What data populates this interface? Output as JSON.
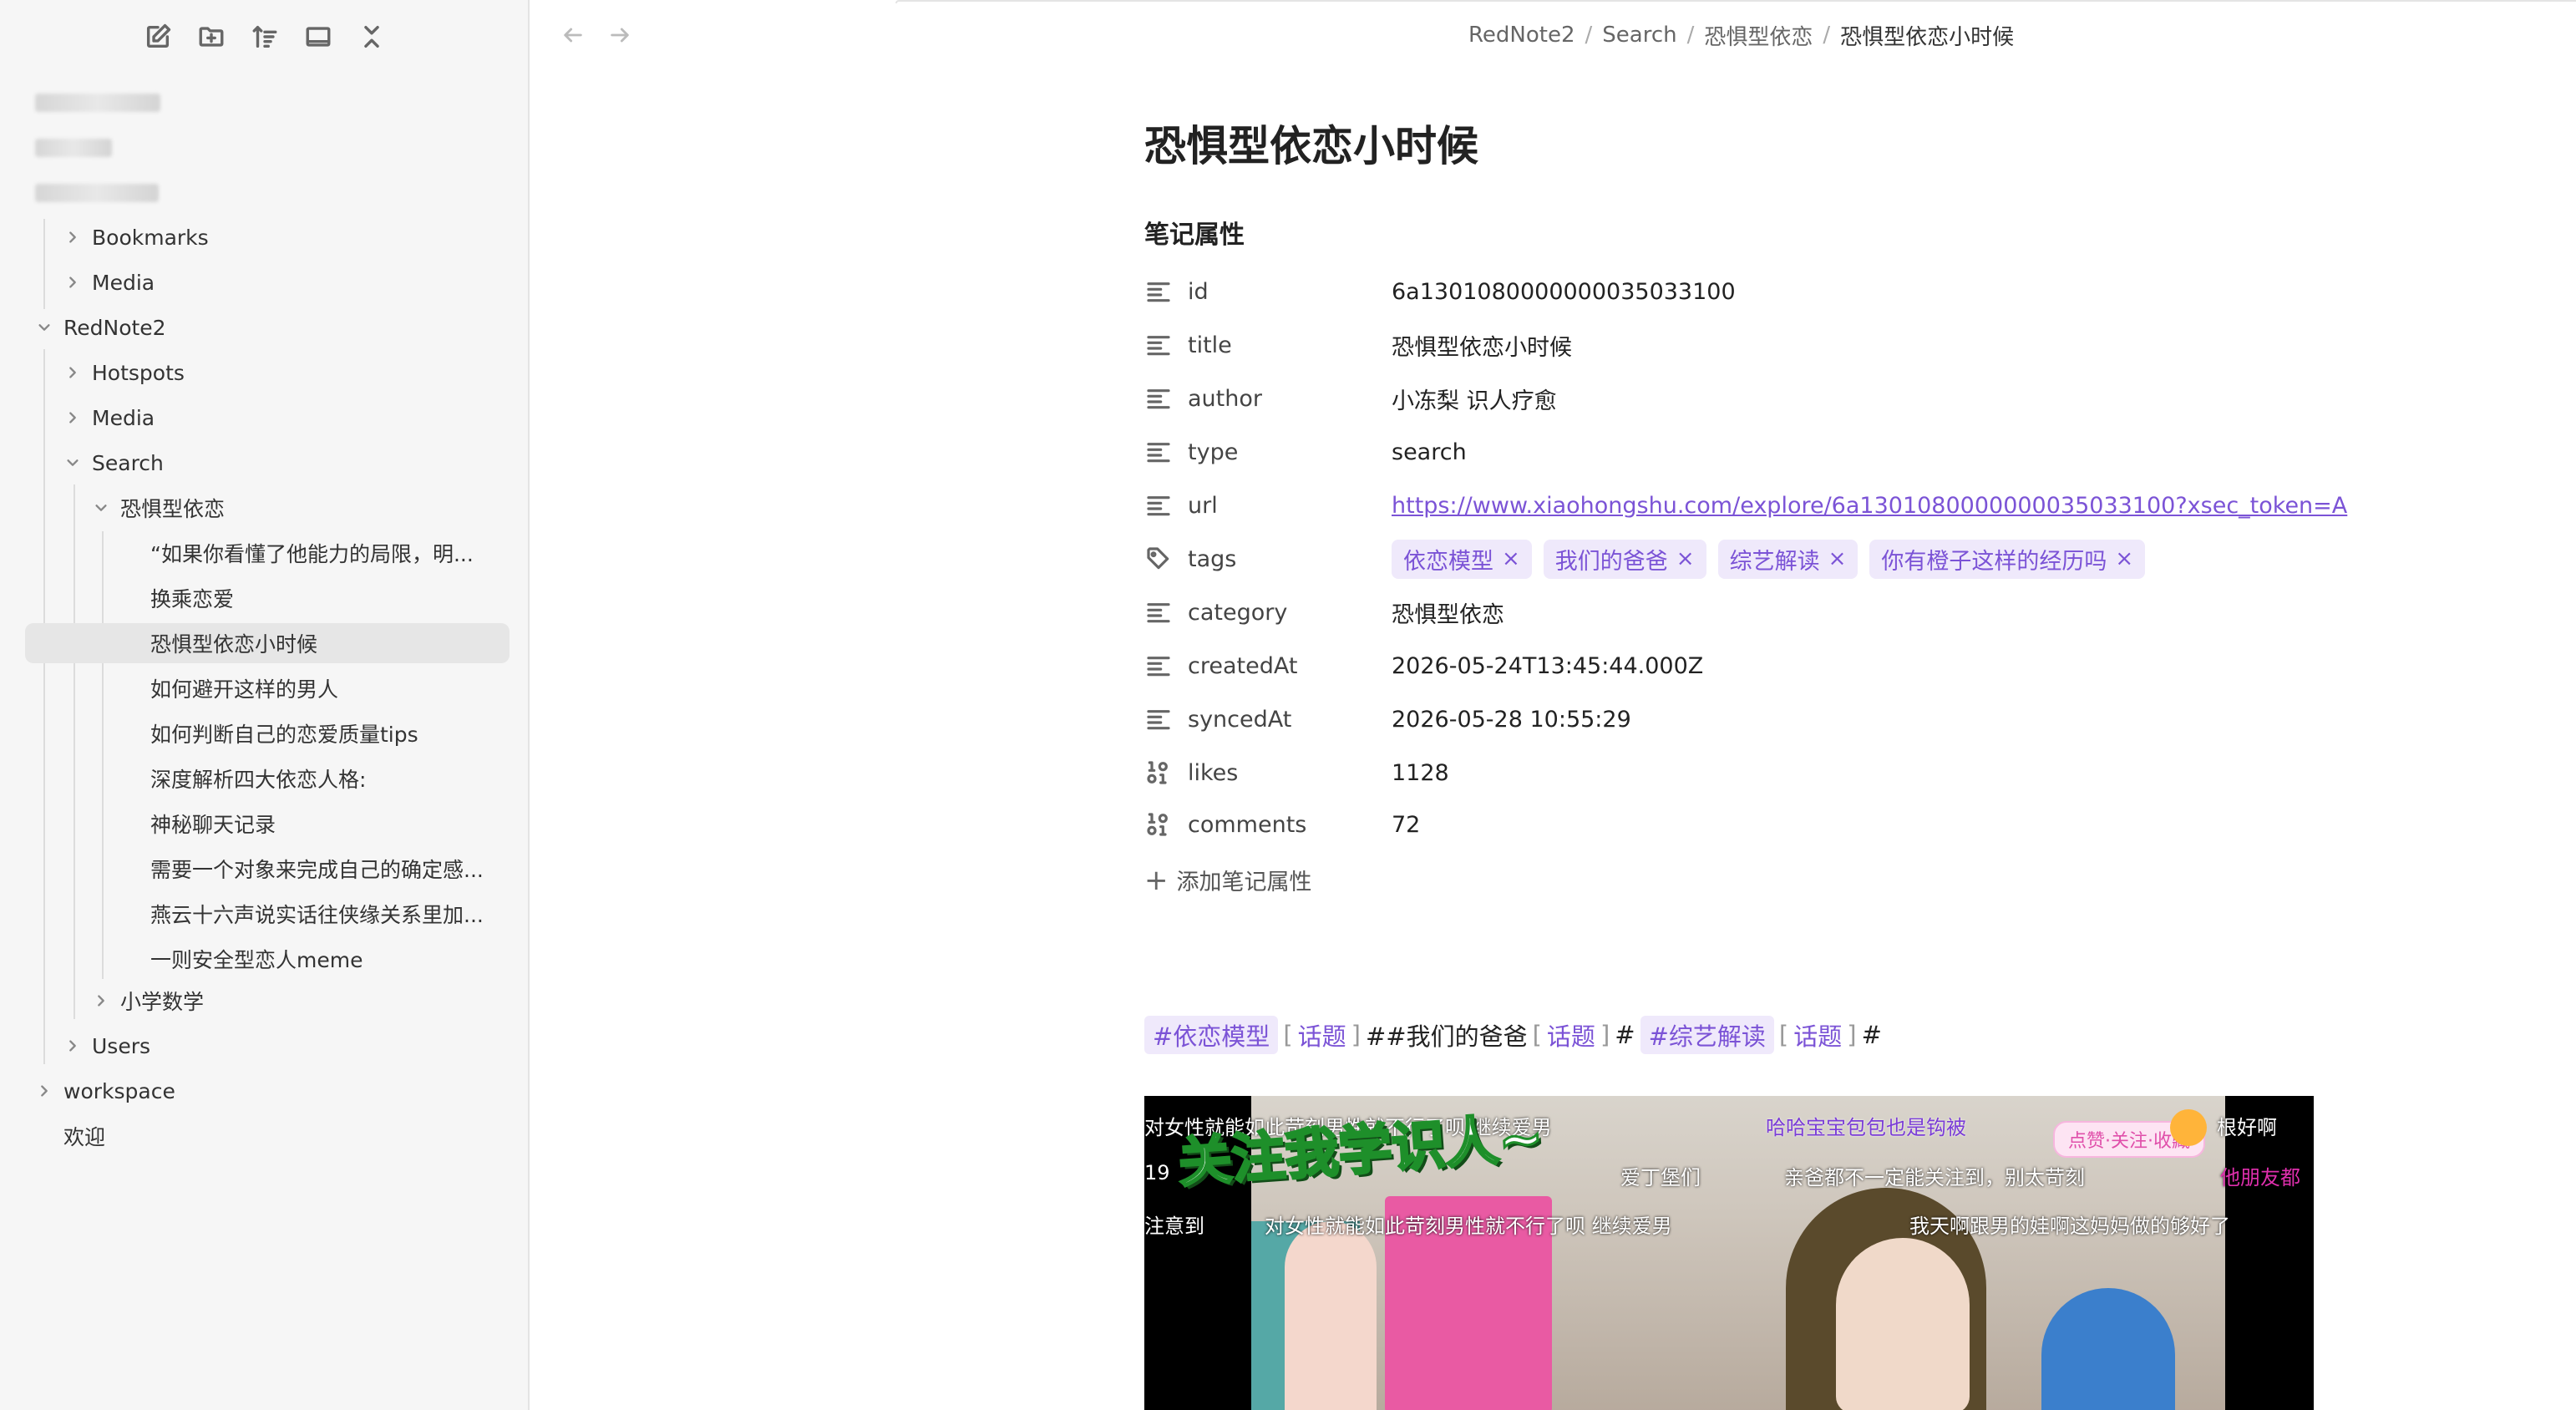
{
  "sidebar": {
    "toolbar": {
      "new_note": "new-note-icon",
      "new_folder": "new-folder-icon",
      "sort": "sort-icon",
      "layout": "layout-icon",
      "collapse": "collapse-icon"
    },
    "tree": [
      {
        "label": "Bookmarks"
      },
      {
        "label": "Media"
      },
      {
        "label": "RedNote2"
      },
      {
        "label": "Hotspots"
      },
      {
        "label": "Media"
      },
      {
        "label": "Search"
      },
      {
        "label": "恐惧型依恋"
      },
      {
        "label": "“如果你看懂了他能力的局限，明..."
      },
      {
        "label": "换乘恋爱"
      },
      {
        "label": "恐惧型依恋小时候"
      },
      {
        "label": "如何避开这样的男人"
      },
      {
        "label": "如何判断自己的恋爱质量tips"
      },
      {
        "label": "深度解析四大依恋人格:"
      },
      {
        "label": "神秘聊天记录"
      },
      {
        "label": "需要一个对象来完成自己的确定感..."
      },
      {
        "label": "燕云十六声说实话往侠缘关系里加..."
      },
      {
        "label": "一则安全型恋人meme"
      },
      {
        "label": "小学数学"
      },
      {
        "label": "Users"
      },
      {
        "label": "workspace"
      },
      {
        "label": "欢迎"
      }
    ]
  },
  "breadcrumb": [
    "RedNote2",
    "Search",
    "恐惧型依恋",
    "恐惧型依恋小时候"
  ],
  "page": {
    "title": "恐惧型依恋小时候",
    "props_heading": "笔记属性",
    "props": {
      "id": {
        "key": "id",
        "value": "6a1301080000000035033100"
      },
      "title": {
        "key": "title",
        "value": "恐惧型依恋小时候"
      },
      "author": {
        "key": "author",
        "value": "小冻梨 识人疗愈"
      },
      "type": {
        "key": "type",
        "value": "search"
      },
      "url": {
        "key": "url",
        "value": "https://www.xiaohongshu.com/explore/6a1301080000000035033100?xsec_token=A"
      },
      "tags": {
        "key": "tags",
        "values": [
          "依恋模型",
          "我们的爸爸",
          "综艺解读",
          "你有橙子这样的经历吗"
        ]
      },
      "category": {
        "key": "category",
        "value": "恐惧型依恋"
      },
      "createdAt": {
        "key": "createdAt",
        "value": "2026-05-24T13:45:44.000Z"
      },
      "syncedAt": {
        "key": "syncedAt",
        "value": "2026-05-28 10:55:29"
      },
      "likes": {
        "key": "likes",
        "value": "1128"
      },
      "comments": {
        "key": "comments",
        "value": "72"
      }
    },
    "add_prop": "添加笔记属性",
    "hashtags": {
      "tag1": "#依恋模型",
      "topic1": "话题",
      "plain1": "##我们的爸爸",
      "topic2": "话题",
      "plain2": "#",
      "tag2": "#综艺解读",
      "topic3": "话题",
      "plain3": "#"
    },
    "video": {
      "big_text": "关注我学识人~",
      "sub1": "对女性就能如此苛刻男性就不行了呗 继续爱男",
      "sub2": "哈哈宝宝包包也是钩被",
      "sub3": "根好啊",
      "sub4": "19",
      "sub5": "爱丁堡们",
      "sub6": "亲爸都不一定能关注到，别太苛刻",
      "sub7": "他朋友都",
      "sub8": "注意到",
      "sub9": "对女性就能如此苛刻男性就不行了呗 继续爱男",
      "sub10": "我天啊跟男的娃啊这妈妈做的够好了",
      "badge": "点赞·关注·收藏"
    }
  },
  "colors": {
    "accent": "#7b53d6",
    "tag_bg": "#efe9fb",
    "sidebar_bg": "#f6f6f6"
  }
}
